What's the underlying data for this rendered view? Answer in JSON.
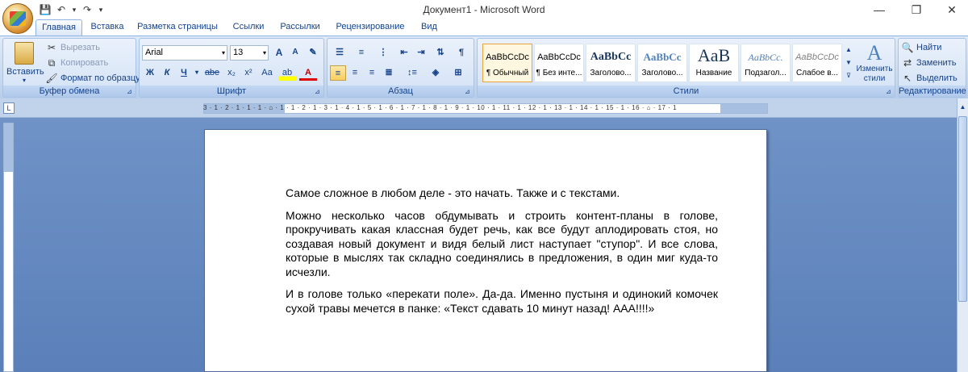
{
  "window": {
    "title": "Документ1 - Microsoft Word",
    "controls": {
      "minimize": "—",
      "maximize": "❐",
      "close": "✕"
    }
  },
  "qat": {
    "save": "💾",
    "undo": "↶",
    "redo": "↷",
    "more": "▾"
  },
  "tabs": [
    {
      "label": "Главная",
      "active": true
    },
    {
      "label": "Вставка"
    },
    {
      "label": "Разметка страницы"
    },
    {
      "label": "Ссылки"
    },
    {
      "label": "Рассылки"
    },
    {
      "label": "Рецензирование"
    },
    {
      "label": "Вид"
    }
  ],
  "clipboard": {
    "group_label": "Буфер обмена",
    "paste": "Вставить",
    "cut": "Вырезать",
    "copy": "Копировать",
    "format_painter": "Формат по образцу"
  },
  "font": {
    "group_label": "Шрифт",
    "font_name": "Arial",
    "font_size": "13",
    "grow": "A",
    "shrink": "A",
    "bold": "Ж",
    "italic": "К",
    "underline": "Ч",
    "strike": "abe",
    "subscript": "x₂",
    "superscript": "x²",
    "change_case": "Aa",
    "highlight": "ab",
    "font_color": "A"
  },
  "paragraph": {
    "group_label": "Абзац",
    "pilcrow": "¶"
  },
  "styles": {
    "group_label": "Стили",
    "items": [
      {
        "sample": "AaBbCcDc",
        "name": "¶ Обычный",
        "active": true
      },
      {
        "sample": "AaBbCcDc",
        "name": "¶ Без инте..."
      },
      {
        "sample": "AaBbCc",
        "name": "Заголово..."
      },
      {
        "sample": "AaBbCc",
        "name": "Заголово..."
      },
      {
        "sample": "AaB",
        "name": "Название"
      },
      {
        "sample": "AaBbCc.",
        "name": "Подзагол..."
      },
      {
        "sample": "AaBbCcDc",
        "name": "Слабое в..."
      }
    ],
    "change_styles": "Изменить стили"
  },
  "editing": {
    "group_label": "Редактирование",
    "find": "Найти",
    "replace": "Заменить",
    "select": "Выделить"
  },
  "ruler": {
    "numbers": "3 · 1 · 2 · 1 · 1 · 1 · ⌂ · 1 · 1 · 2 · 1 · 3 · 1 · 4 · 1 · 5 · 1 · 6 · 1 · 7 · 1 · 8 · 1 · 9 · 1 · 10 · 1 · 11 · 1 · 12 · 1 · 13 · 1 · 14 · 1 · 15 · 1 · 16 · ⌂ · 17 · 1",
    "toggle": "L"
  },
  "document": {
    "paragraphs": [
      "Самое сложное в любом деле - это начать. Также и с текстами.",
      "Можно несколько часов обдумывать и строить контент-планы в голове, прокручивать какая классная будет речь, как все будут аплодировать стоя, но создавая новый документ и видя белый лист наступает \"ступор\". И все слова, которые в мыслях так складно соединялись в предложения, в один миг куда-то исчезли.",
      "И в голове только «перекати поле». Да-да. Именно пустыня и одинокий комочек сухой травы мечется в панке: «Текст сдавать 10 минут назад! ААА!!!!»"
    ]
  }
}
